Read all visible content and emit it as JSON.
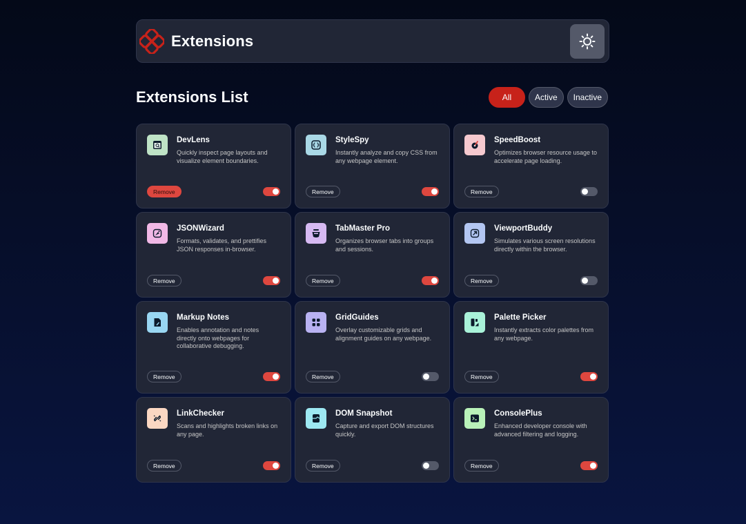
{
  "header": {
    "brand": "Extensions"
  },
  "list": {
    "title": "Extensions List"
  },
  "filters": [
    "All",
    "Active",
    "Inactive"
  ],
  "colors": {
    "accent": "#de473f",
    "accent_dark": "#c7221a",
    "card": "#212636",
    "bg": "#040918"
  },
  "extensions": [
    {
      "name": "DevLens",
      "description": "Quickly inspect page layouts and visualize element boundaries.",
      "icon": "devlens-icon",
      "icon_bg": "#bfe3c6",
      "active": true,
      "remove": "Remove"
    },
    {
      "name": "StyleSpy",
      "description": "Instantly analyze and copy CSS from any webpage element.",
      "icon": "stylespy-icon",
      "icon_bg": "#a9d8e6",
      "active": true,
      "remove": "Remove"
    },
    {
      "name": "SpeedBoost",
      "description": "Optimizes browser resource usage to accelerate page loading.",
      "icon": "speedboost-icon",
      "icon_bg": "#f6c9cf",
      "active": false,
      "remove": "Remove"
    },
    {
      "name": "JSONWizard",
      "description": "Formats, validates, and prettifies JSON responses in-browser.",
      "icon": "jsonwizard-icon",
      "icon_bg": "#f1b8e6",
      "active": true,
      "remove": "Remove"
    },
    {
      "name": "TabMaster Pro",
      "description": "Organizes browser tabs into groups and sessions.",
      "icon": "tabmaster-icon",
      "icon_bg": "#d6b9f2",
      "active": true,
      "remove": "Remove"
    },
    {
      "name": "ViewportBuddy",
      "description": "Simulates various screen resolutions directly within the browser.",
      "icon": "viewportbuddy-icon",
      "icon_bg": "#b3c6f2",
      "active": false,
      "remove": "Remove"
    },
    {
      "name": "Markup Notes",
      "description": "Enables annotation and notes directly onto webpages for collaborative debugging.",
      "icon": "markupnotes-icon",
      "icon_bg": "#99d6f2",
      "active": true,
      "remove": "Remove"
    },
    {
      "name": "GridGuides",
      "description": "Overlay customizable grids and alignment guides on any webpage.",
      "icon": "gridguides-icon",
      "icon_bg": "#b9b2f2",
      "active": false,
      "remove": "Remove"
    },
    {
      "name": "Palette Picker",
      "description": "Instantly extracts color palettes from any webpage.",
      "icon": "palettepicker-icon",
      "icon_bg": "#a9f2d9",
      "active": true,
      "remove": "Remove"
    },
    {
      "name": "LinkChecker",
      "description": "Scans and highlights broken links on any page.",
      "icon": "linkchecker-icon",
      "icon_bg": "#fbd7c2",
      "active": true,
      "remove": "Remove"
    },
    {
      "name": "DOM Snapshot",
      "description": "Capture and export DOM structures quickly.",
      "icon": "domsnapshot-icon",
      "icon_bg": "#9de8f2",
      "active": false,
      "remove": "Remove"
    },
    {
      "name": "ConsolePlus",
      "description": "Enhanced developer console with advanced filtering and logging.",
      "icon": "consoleplus-icon",
      "icon_bg": "#b9f2b9",
      "active": true,
      "remove": "Remove"
    }
  ]
}
